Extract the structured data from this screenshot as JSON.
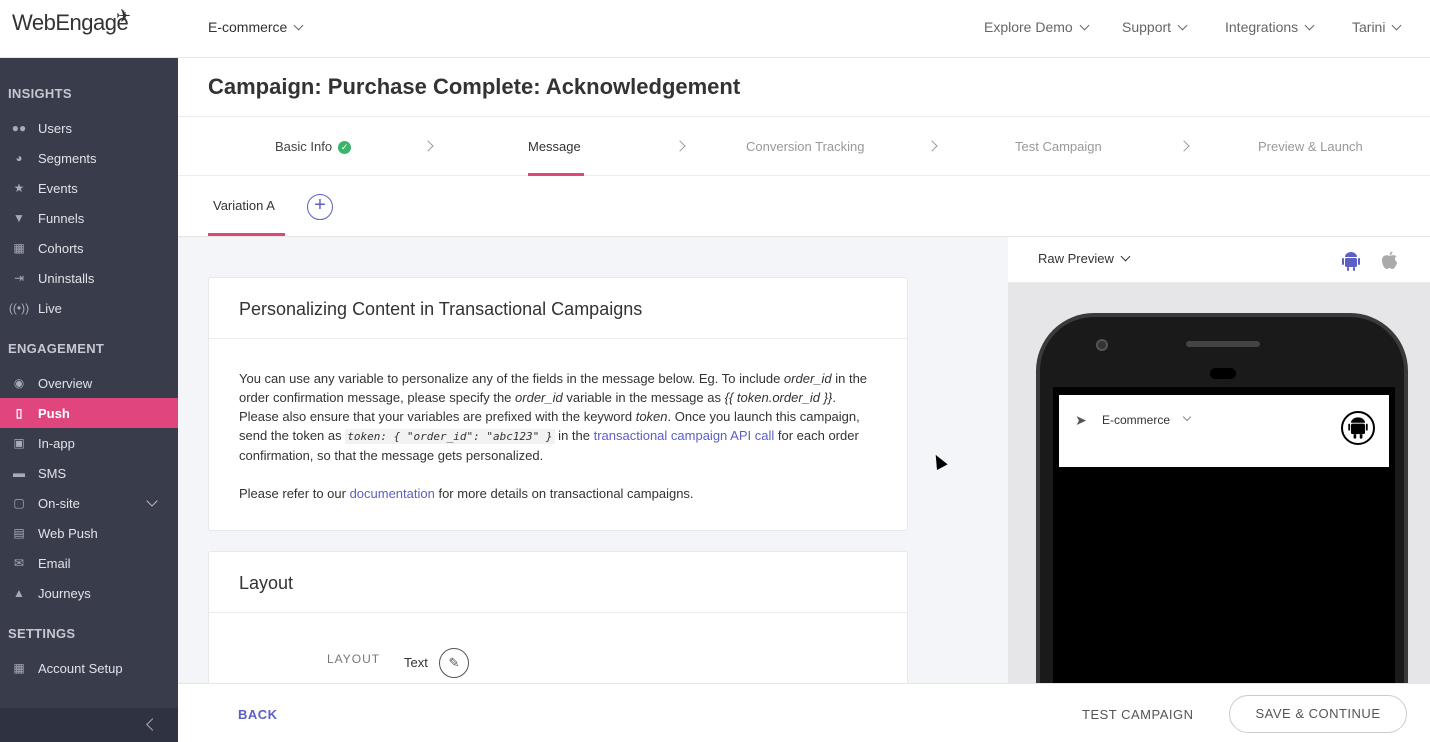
{
  "brand": {
    "logo_text": "WebEngage"
  },
  "topbar": {
    "project": "E-commerce",
    "nav": [
      "Explore Demo",
      "Support",
      "Integrations",
      "Tarini"
    ]
  },
  "sidebar": {
    "sections": [
      "INSIGHTS",
      "ENGAGEMENT",
      "SETTINGS"
    ],
    "insights": [
      {
        "label": "Users",
        "icon": "users-icon"
      },
      {
        "label": "Segments",
        "icon": "pie-icon"
      },
      {
        "label": "Events",
        "icon": "star-icon"
      },
      {
        "label": "Funnels",
        "icon": "funnel-icon"
      },
      {
        "label": "Cohorts",
        "icon": "grid-icon"
      },
      {
        "label": "Uninstalls",
        "icon": "exit-icon"
      },
      {
        "label": "Live",
        "icon": "broadcast-icon"
      }
    ],
    "engagement": [
      {
        "label": "Overview",
        "icon": "eye-icon"
      },
      {
        "label": "Push",
        "icon": "mobile-icon"
      },
      {
        "label": "In-app",
        "icon": "phone-icon"
      },
      {
        "label": "SMS",
        "icon": "sms-icon"
      },
      {
        "label": "On-site",
        "icon": "window-icon"
      },
      {
        "label": "Web Push",
        "icon": "browser-icon"
      },
      {
        "label": "Email",
        "icon": "mail-icon"
      },
      {
        "label": "Journeys",
        "icon": "rocket-icon"
      }
    ],
    "settings": [
      {
        "label": "Account Setup",
        "icon": "gear-icon"
      }
    ]
  },
  "page": {
    "title": "Campaign: Purchase Complete: Acknowledgement"
  },
  "steps": [
    "Basic Info",
    "Message",
    "Conversion Tracking",
    "Test Campaign",
    "Preview & Launch"
  ],
  "variation": {
    "tab": "Variation A",
    "add": "+"
  },
  "personalize": {
    "title": "Personalizing Content in Transactional Campaigns",
    "p1_a": "You can use any variable to personalize any of the fields in the message below. Eg. To include ",
    "p1_var": "order_id",
    "p1_b": " in the order confirmation message, please specify the ",
    "p1_var2": "order_id",
    "p1_c": " variable in the message as ",
    "p1_token": "{{ token.order_id }}",
    "p1_d": ". Please also ensure that your variables are prefixed with the keyword ",
    "p1_kw": "token",
    "p1_e": ". Once you launch this campaign, send the token as ",
    "p1_code": "token: { \"order_id\": \"abc123\" }",
    "p1_f": " in the ",
    "p1_link": "transactional campaign API call",
    "p1_g": " for each order confirmation, so that the message gets personalized.",
    "p2_a": "Please refer to our ",
    "p2_link": "documentation",
    "p2_b": " for more details on transactional campaigns."
  },
  "layout_card": {
    "title": "Layout",
    "label": "LAYOUT",
    "value": "Text"
  },
  "preview": {
    "mode": "Raw Preview",
    "app_name": "E-commerce"
  },
  "footer": {
    "back": "BACK",
    "test": "TEST CAMPAIGN",
    "save": "SAVE & CONTINUE"
  },
  "colors": {
    "accent": "#e0467d",
    "link": "#5c5fc4",
    "sidebar": "#393c4b"
  }
}
